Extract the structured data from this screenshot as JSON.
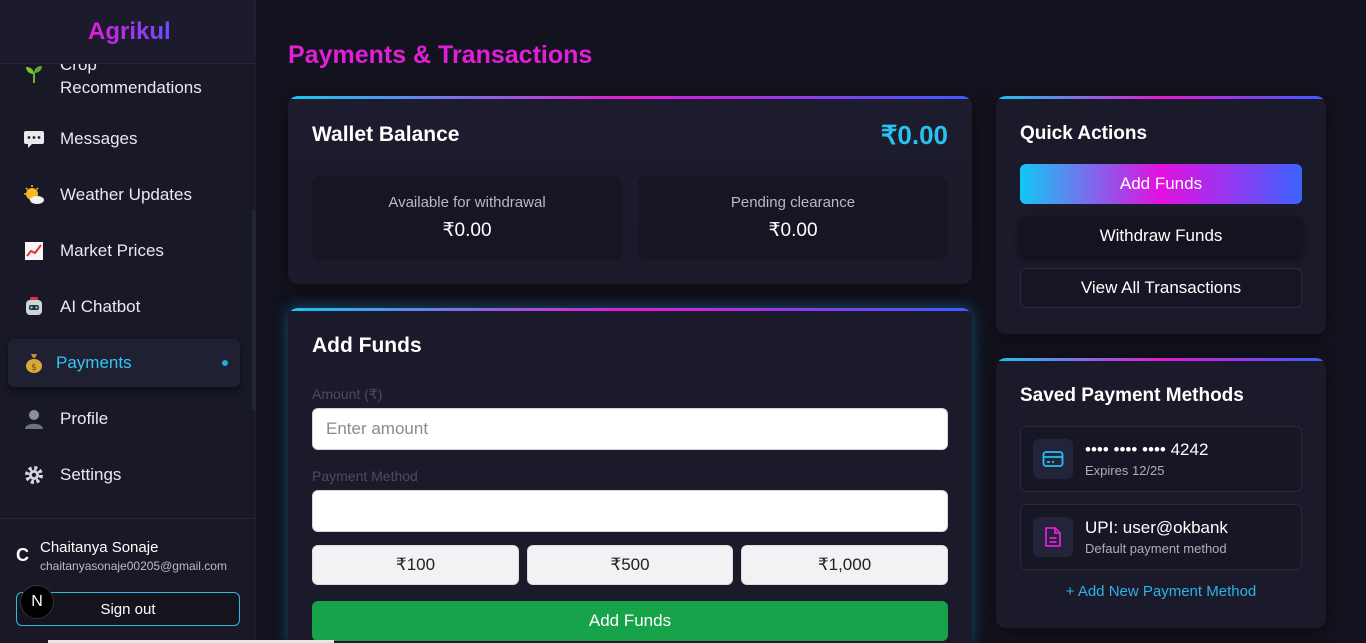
{
  "brand": "Agrikul",
  "sidebar": {
    "items": [
      {
        "label": "Crop\nRecommendations",
        "icon": "sprout-icon"
      },
      {
        "label": "Messages",
        "icon": "chat-icon"
      },
      {
        "label": "Weather Updates",
        "icon": "sun-cloud-icon"
      },
      {
        "label": "Market Prices",
        "icon": "chart-icon"
      },
      {
        "label": "AI Chatbot",
        "icon": "robot-icon"
      },
      {
        "label": "Payments",
        "icon": "money-bag-icon",
        "active": true
      },
      {
        "label": "Profile",
        "icon": "person-icon"
      },
      {
        "label": "Settings",
        "icon": "gear-icon"
      }
    ]
  },
  "user": {
    "initial": "C",
    "name": "Chaitanya Sonaje",
    "email": "chaitanyasonaje00205@gmail.com",
    "signout_label": "Sign out"
  },
  "n_badge": "N",
  "page_title": "Payments & Transactions",
  "wallet": {
    "title": "Wallet Balance",
    "amount": "₹0.00",
    "available_label": "Available for withdrawal",
    "available_value": "₹0.00",
    "pending_label": "Pending clearance",
    "pending_value": "₹0.00"
  },
  "add_funds": {
    "title": "Add Funds",
    "amount_label": "Amount (₹)",
    "amount_placeholder": "Enter amount",
    "method_label": "Payment Method",
    "method_value": "",
    "quick_amounts": [
      "₹100",
      "₹500",
      "₹1,000"
    ],
    "submit_label": "Add Funds"
  },
  "quick_actions": {
    "title": "Quick Actions",
    "add_label": "Add Funds",
    "withdraw_label": "Withdraw Funds",
    "view_label": "View All Transactions"
  },
  "saved_methods": {
    "title": "Saved Payment Methods",
    "methods": [
      {
        "main": "•••• •••• •••• 4242",
        "sub": "Expires 12/25",
        "icon": "credit-card-icon"
      },
      {
        "main": "UPI: user@okbank",
        "sub": "Default payment method",
        "icon": "document-icon"
      }
    ],
    "add_label": "+ Add New Payment Method"
  },
  "colors": {
    "accent_cyan": "#28c2f0",
    "accent_magenta": "#e11fd6",
    "success_green": "#17a34a"
  }
}
